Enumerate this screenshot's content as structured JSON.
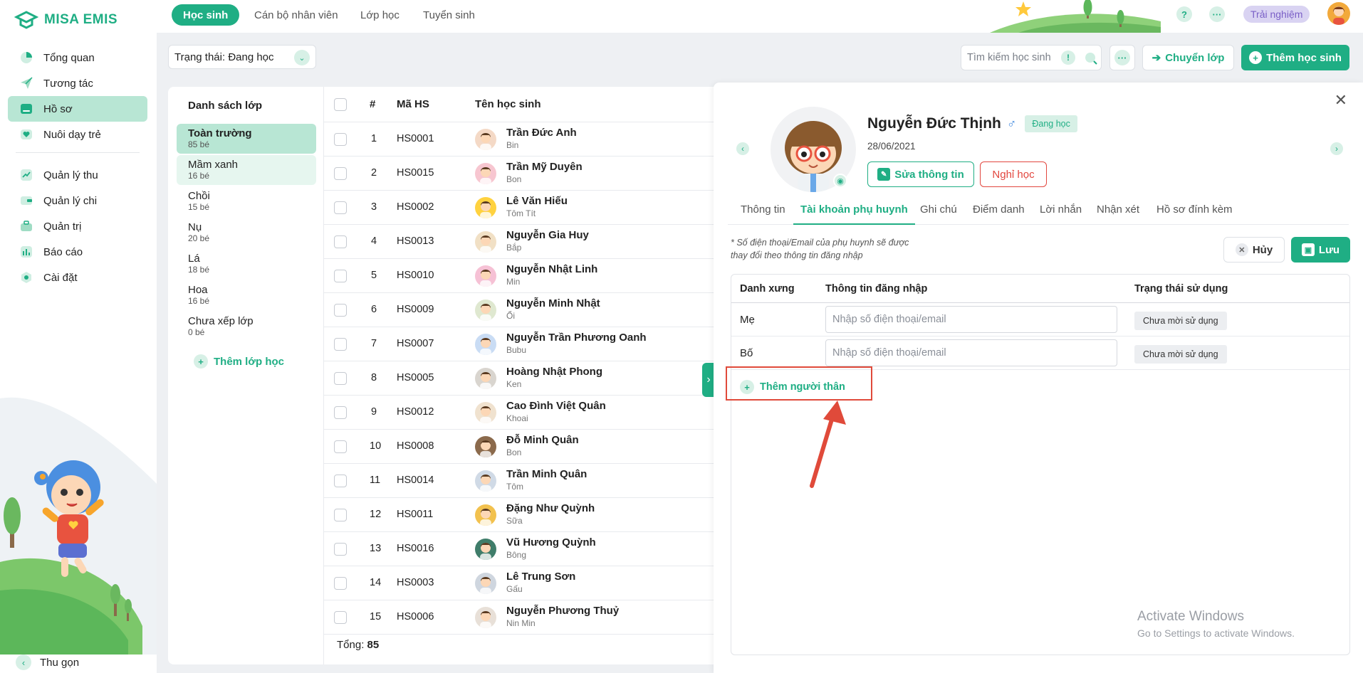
{
  "app": {
    "name": "MISA EMIS"
  },
  "sidebar": {
    "items": [
      {
        "label": "Tổng quan",
        "icon": "pie-chart-icon"
      },
      {
        "label": "Tương tác",
        "icon": "paper-plane-icon"
      },
      {
        "label": "Hồ sơ",
        "icon": "folder-icon",
        "active": true
      },
      {
        "label": "Nuôi dạy trẻ",
        "icon": "heart-icon"
      },
      {
        "label": "Quản lý thu",
        "icon": "trend-up-icon"
      },
      {
        "label": "Quản lý chi",
        "icon": "wallet-icon"
      },
      {
        "label": "Quản trị",
        "icon": "briefcase-icon"
      },
      {
        "label": "Báo cáo",
        "icon": "bar-chart-icon"
      },
      {
        "label": "Cài đặt",
        "icon": "gear-icon"
      }
    ],
    "collapse_label": "Thu gọn"
  },
  "topnav": {
    "tabs": [
      "Học sinh",
      "Cán bộ nhân viên",
      "Lớp học",
      "Tuyển sinh"
    ],
    "trial_label": "Trải nghiệm"
  },
  "toolbar": {
    "status_filter": "Trạng thái: Đang học",
    "search_placeholder": "Tìm kiếm học sinh",
    "move_class_label": "Chuyển lớp",
    "add_student_label": "Thêm học sinh"
  },
  "classes": {
    "title": "Danh sách lớp",
    "items": [
      {
        "name": "Toàn trường",
        "count": "85 bé"
      },
      {
        "name": "Mầm xanh",
        "count": "16 bé"
      },
      {
        "name": "Chồi",
        "count": "15 bé"
      },
      {
        "name": "Nụ",
        "count": "20 bé"
      },
      {
        "name": "Lá",
        "count": "18 bé"
      },
      {
        "name": "Hoa",
        "count": "16 bé"
      },
      {
        "name": "Chưa xếp lớp",
        "count": "0 bé"
      }
    ],
    "add_label": "Thêm lớp học"
  },
  "table": {
    "headers": {
      "index": "#",
      "code": "Mã HS",
      "name": "Tên học sinh"
    },
    "rows": [
      {
        "no": "1",
        "code": "HS0001",
        "name": "Trần Đức Anh",
        "nick": "Bin"
      },
      {
        "no": "2",
        "code": "HS0015",
        "name": "Trần Mỹ Duyên",
        "nick": "Bon"
      },
      {
        "no": "3",
        "code": "HS0002",
        "name": "Lê Văn Hiếu",
        "nick": "Tôm Tít"
      },
      {
        "no": "4",
        "code": "HS0013",
        "name": "Nguyễn Gia Huy",
        "nick": "Bắp"
      },
      {
        "no": "5",
        "code": "HS0010",
        "name": "Nguyễn Nhật Linh",
        "nick": "Min"
      },
      {
        "no": "6",
        "code": "HS0009",
        "name": "Nguyễn Minh Nhật",
        "nick": "Ổi"
      },
      {
        "no": "7",
        "code": "HS0007",
        "name": "Nguyễn Trần Phương Oanh",
        "nick": "Bubu"
      },
      {
        "no": "8",
        "code": "HS0005",
        "name": "Hoàng Nhật Phong",
        "nick": "Ken"
      },
      {
        "no": "9",
        "code": "HS0012",
        "name": "Cao Đình Việt Quân",
        "nick": "Khoai"
      },
      {
        "no": "10",
        "code": "HS0008",
        "name": "Đỗ Minh Quân",
        "nick": "Bon"
      },
      {
        "no": "11",
        "code": "HS0014",
        "name": "Trần Minh Quân",
        "nick": "Tôm"
      },
      {
        "no": "12",
        "code": "HS0011",
        "name": "Đặng Như Quỳnh",
        "nick": "Sữa"
      },
      {
        "no": "13",
        "code": "HS0016",
        "name": "Vũ Hương Quỳnh",
        "nick": "Bông"
      },
      {
        "no": "14",
        "code": "HS0003",
        "name": "Lê Trung Sơn",
        "nick": "Gấu"
      },
      {
        "no": "15",
        "code": "HS0006",
        "name": "Nguyễn Phương Thuỷ",
        "nick": "Nin Min"
      }
    ],
    "total_label": "Tổng:",
    "total_value": "85"
  },
  "detail": {
    "name": "Nguyễn Đức Thịnh",
    "gender_symbol": "♂",
    "status": "Đang học",
    "dob": "28/06/2021",
    "edit_label": "Sửa thông tin",
    "leave_label": "Nghỉ học",
    "tabs": [
      "Thông tin",
      "Tài khoản phụ huynh",
      "Ghi chú",
      "Điểm danh",
      "Lời nhắn",
      "Nhận xét",
      "Hồ sơ đính kèm"
    ],
    "note": "* Số điện thoại/Email của phụ huynh sẽ được thay đổi theo thông tin đăng nhập",
    "cancel_label": "Hủy",
    "save_label": "Lưu",
    "parent_table": {
      "headers": [
        "Danh xưng",
        "Thông tin đăng nhập",
        "Trạng thái sử dụng"
      ],
      "rows": [
        {
          "title": "Mẹ",
          "placeholder": "Nhập số điện thoại/email",
          "status": "Chưa mời sử dụng"
        },
        {
          "title": "Bố",
          "placeholder": "Nhập số điện thoại/email",
          "status": "Chưa mời sử dụng"
        }
      ]
    },
    "add_relative_label": "Thêm người thân"
  },
  "watermark": {
    "title": "Activate Windows",
    "subtitle": "Go to Settings to activate Windows."
  },
  "colors": {
    "accent": "#1fae84",
    "active_bg": "#b8e6d4",
    "danger": "#e2473f",
    "highlight": "#e04a3a"
  }
}
